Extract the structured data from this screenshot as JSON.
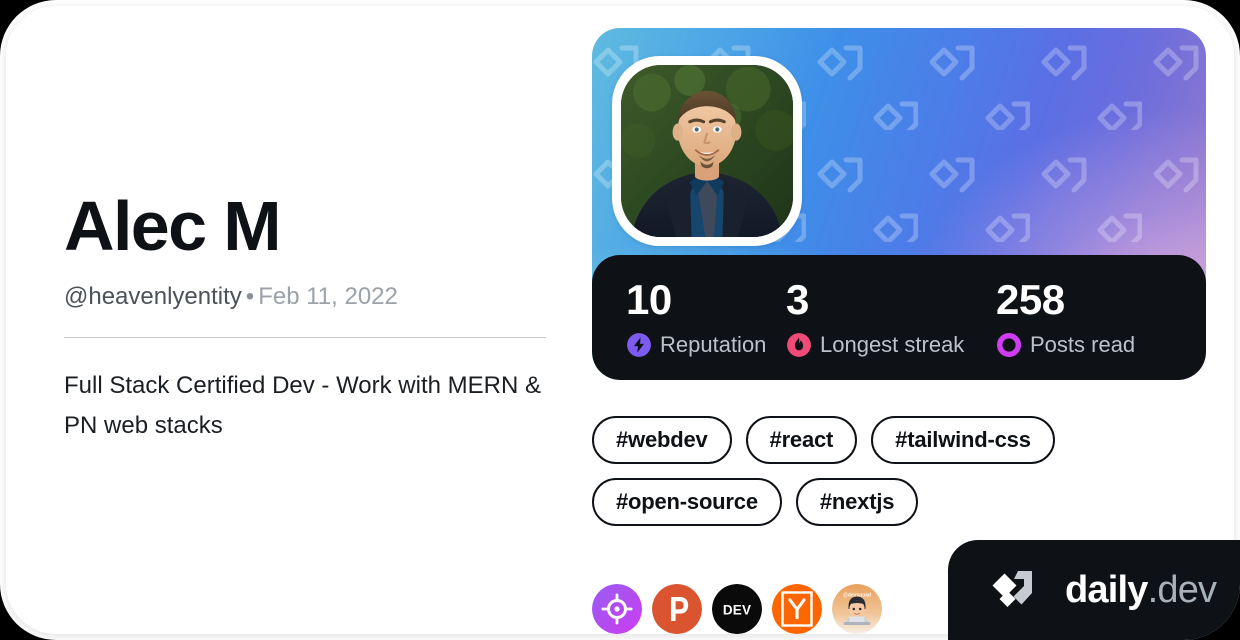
{
  "card": {
    "background": "#FFFFFF",
    "outer_background": "#000000"
  },
  "profile": {
    "display_name": "Alec M",
    "handle": "@heavenlyentity",
    "separator": "•",
    "join_date": "Feb 11, 2022",
    "bio": "Full Stack Certified Dev - Work with MERN & PN web stacks",
    "avatar_alt": "profile-photo"
  },
  "cover": {
    "watermark": "daily-dev-logo-pattern",
    "gradient_from": "#5FBBDF",
    "gradient_to": "#A98BC9"
  },
  "stats": {
    "background": "#0E1217",
    "items": [
      {
        "value": "10",
        "label": "Reputation",
        "icon": "bolt-icon",
        "color": "#7C5CF0"
      },
      {
        "value": "3",
        "label": "Longest streak",
        "icon": "flame-icon",
        "color": "#F04A78"
      },
      {
        "value": "258",
        "label": "Posts read",
        "icon": "posts-read-icon",
        "color": "#CE3DF3"
      }
    ]
  },
  "tags": [
    {
      "label": "#webdev"
    },
    {
      "label": "#react"
    },
    {
      "label": "#tailwind-css"
    },
    {
      "label": "#open-source"
    },
    {
      "label": "#nextjs"
    }
  ],
  "socials": [
    {
      "name": "roadmap-icon",
      "title": "roadmap.sh",
      "color": "#A855F7"
    },
    {
      "name": "product-hunt-icon",
      "title": "Product Hunt",
      "color": "#DA552F"
    },
    {
      "name": "dev-to-icon",
      "title": "DEV",
      "color": "#0A0A0A"
    },
    {
      "name": "hacker-news-icon",
      "title": "Hacker News",
      "color": "#FF6600"
    },
    {
      "name": "avatar-link-icon",
      "title": "Profile",
      "color": "#E8A36A"
    }
  ],
  "brand": {
    "name": "daily",
    "tld": ".dev",
    "logo": "daily-dev-logo",
    "background": "#0E1217"
  }
}
